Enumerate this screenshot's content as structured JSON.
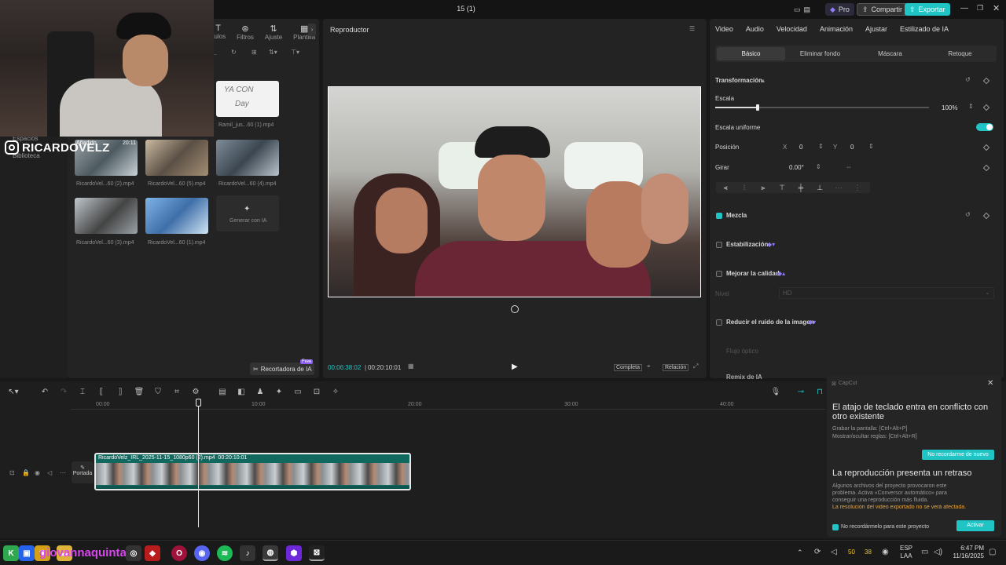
{
  "window": {
    "title": "15 (1)"
  },
  "header": {
    "pro_label": "Pro",
    "share_label": "Compartir",
    "export_label": "Exportar"
  },
  "media": {
    "toolbar_tabs": [
      "ítulos",
      "Filtros",
      "Ajuste",
      "Plantilla"
    ],
    "sort_label": "se ...",
    "side_items": [
      "Espacios",
      "Biblioteca"
    ],
    "clips": [
      {
        "name": "Ramil_jus...60 (1).mp4",
        "duration": ""
      },
      {
        "name": "RicardoVel...60 (2).mp4",
        "duration": "20:11"
      },
      {
        "name": "RicardoVel...60 (5).mp4",
        "duration": ""
      },
      {
        "name": "RicardoVel...60 (4).mp4",
        "duration": ""
      },
      {
        "name": "RicardoVel...60 (3).mp4",
        "duration": ""
      },
      {
        "name": "RicardoVel...60 (1).mp4",
        "duration": ""
      }
    ],
    "generate_label": "Generar con IA",
    "ai_cutter_label": "Recortadora de IA",
    "free_badge": "Free",
    "added_label": "Añadido"
  },
  "webcam": {
    "handle": "RICARDOVELZ"
  },
  "player": {
    "title": "Reproductor",
    "current_time": "00:06:38:02",
    "total_time": "00:20:10:01",
    "full_label": "Completa",
    "ratio_label": "Relación"
  },
  "props": {
    "tabs": [
      "Video",
      "Audio",
      "Velocidad",
      "Animación",
      "Ajustar",
      "Estilizado de IA"
    ],
    "subtabs": [
      "Básico",
      "Eliminar fondo",
      "Máscara",
      "Retoque"
    ],
    "transform_label": "Transformación",
    "scale_label": "Escala",
    "scale_value": "100%",
    "scale_fraction": 0.2,
    "uniform_label": "Escala uniforme",
    "position_label": "Posición",
    "pos_x_label": "X",
    "pos_x": "0",
    "pos_y_label": "Y",
    "pos_y": "0",
    "rotate_label": "Girar",
    "rotate_value": "0.00°",
    "blend_label": "Mezcla",
    "stabilize_label": "Estabilización",
    "quality_label": "Mejorar la calidad",
    "level_label": "Nivel",
    "level_value": "HD",
    "denoise_label": "Reducir el ruido de la imagen",
    "optical_flow_label": "Flujo óptico",
    "remix_label": "Remix de IA"
  },
  "timeline": {
    "ticks": [
      "00:00",
      "10:00",
      "20:00",
      "30:00",
      "40:00"
    ],
    "cover_label": "Portada",
    "clip_name": "RicardoVelz_IRL_2025-11-15_1080p60 (2).mp4",
    "clip_duration": "00:20:10:01"
  },
  "notification": {
    "app": "CapCut",
    "title1": "El atajo de teclado entra en conflicto con otro existente",
    "line1": "Grabar la pantalla: [Ctrl+Alt+P]",
    "line2": "Mostrar/ocultar reglas: [Ctrl+Alt+R]",
    "btn1": "No recordarme de nuevo",
    "title2": "La reproducción presenta un retraso",
    "body2": "Algunos archivos del proyecto provocaron este problema. Activa «Conversor automático» para conseguir una reproducción más fluida.",
    "warn2": "La resolución del video exportado no se verá afectada.",
    "checkbox_label": "No recordármelo para este proyecto",
    "btn2": "Activar"
  },
  "taskbar": {
    "overlay_text": "giovannaquintana",
    "lang1": "ESP",
    "lang2": "LAA",
    "time": "6:47 PM",
    "date": "11/16/2025",
    "tray1": "50",
    "tray2": "38"
  }
}
